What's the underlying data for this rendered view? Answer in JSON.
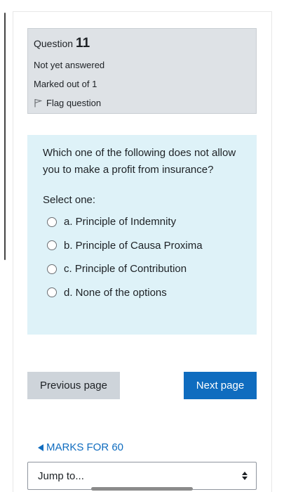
{
  "info": {
    "question_label": "Question",
    "question_number": "11",
    "status": "Not yet answered",
    "marks": "Marked out of 1",
    "flag_label": "Flag question"
  },
  "question": {
    "text": "Which one of the following does not allow you to make a profit from insurance?",
    "prompt": "Select one:",
    "options": [
      {
        "label": "a. Principle of Indemnity"
      },
      {
        "label": "b. Principle of Causa Proxima"
      },
      {
        "label": "c. Principle of Contribution"
      },
      {
        "label": "d. None of the options"
      }
    ]
  },
  "navigation": {
    "previous_label": "Previous page",
    "next_label": "Next page",
    "marks_link": "MARKS FOR 60",
    "jump_placeholder": "Jump to..."
  },
  "colors": {
    "info_bg": "#dee2e6",
    "question_bg": "#def2f8",
    "primary": "#0f6cbf",
    "secondary_btn": "#ced4da"
  },
  "icons": {
    "flag": "flag-icon",
    "radio": "radio-unchecked-icon",
    "back": "triangle-left-icon",
    "select": "updown-arrows-icon"
  }
}
